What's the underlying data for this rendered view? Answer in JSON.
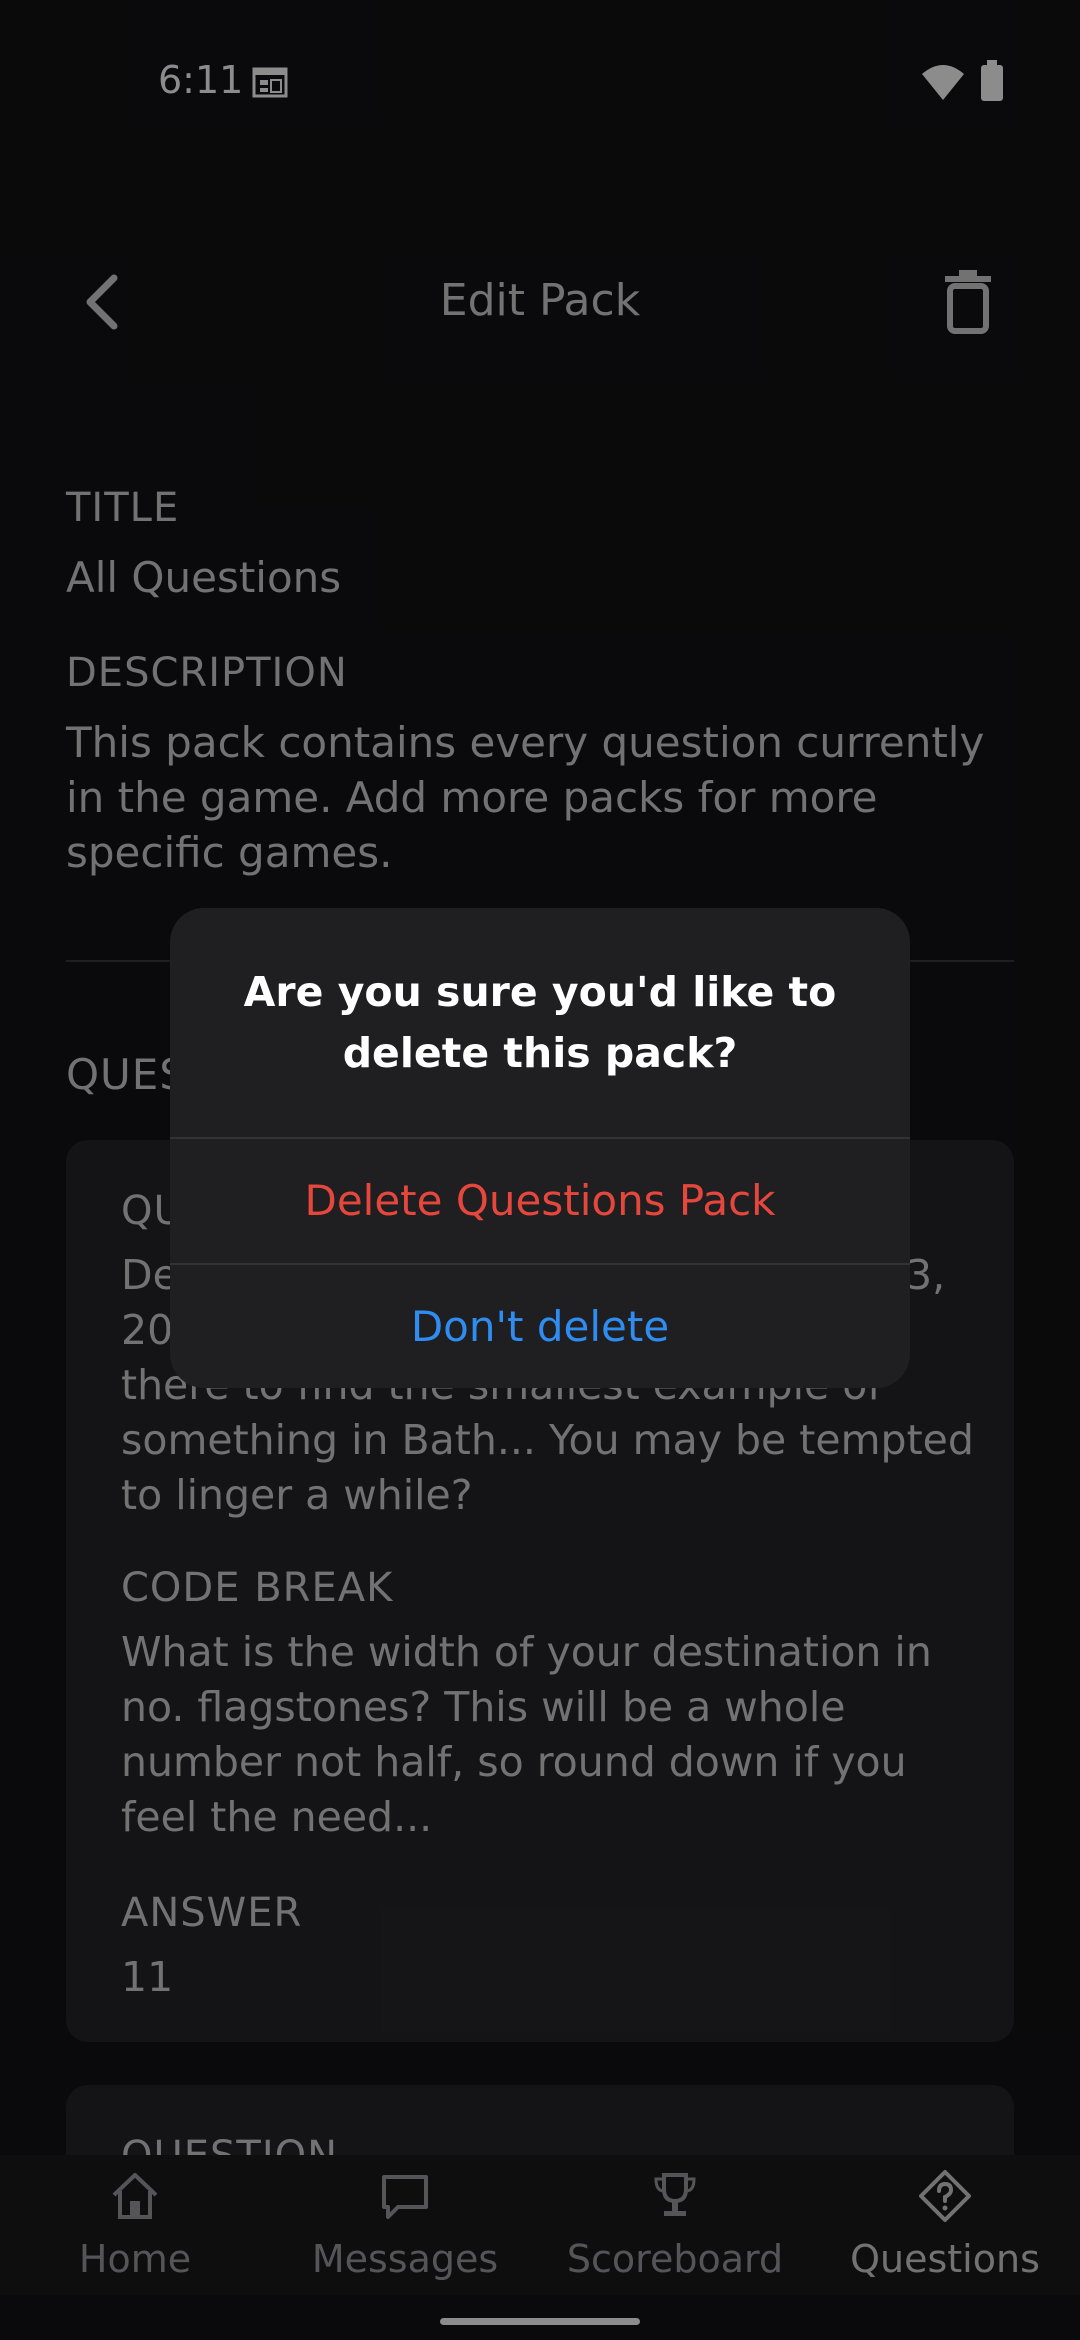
{
  "status_bar": {
    "time": "6:11"
  },
  "header": {
    "title": "Edit Pack"
  },
  "pack": {
    "title_label": "TITLE",
    "title_value": "All Questions",
    "description_label": "DESCRIPTION",
    "description_value": "This pack contains every question currently in the game. Add more packs for more specific games."
  },
  "questions_section": {
    "label": "QUES"
  },
  "card1": {
    "question_label": "QU",
    "question_line1_left": "De",
    "question_line1_right": "3,",
    "question_line2_left": "20",
    "question_line3": "there to find the smallest example of",
    "question_line4": "something in Bath... You may be tempted",
    "question_line5": "to linger a while?",
    "code_break_label": "CODE BREAK",
    "code_break_value": "What is the width of your destination in no. flagstones? This will be a whole number not half, so round down if you feel the need...",
    "answer_label": "ANSWER",
    "answer_value": "11"
  },
  "card2": {
    "question_label": "QUESTION"
  },
  "dialog": {
    "message": "Are you sure you'd like to delete this pack?",
    "delete_label": "Delete Questions Pack",
    "cancel_label": "Don't delete",
    "delete_color": "#e5473d",
    "cancel_color": "#2f8cf0"
  },
  "bottom_nav": {
    "items": [
      {
        "label": "Home",
        "icon": "home-icon"
      },
      {
        "label": "Messages",
        "icon": "chat-bubble-icon"
      },
      {
        "label": "Scoreboard",
        "icon": "trophy-icon"
      },
      {
        "label": "Questions",
        "icon": "question-diamond-icon"
      }
    ]
  }
}
